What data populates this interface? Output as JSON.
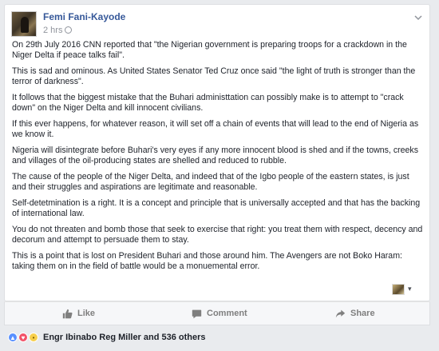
{
  "post": {
    "author": "Femi Fani-Kayode",
    "time": "2 hrs",
    "paragraphs": [
      "On 29th July 2016 CNN reported that \"the Nigerian government is preparing troops for a crackdown in the Niger Delta if peace talks fail\".",
      "This is sad and ominous. As United States Senator Ted Cruz once said \"the light of truth is stronger than the terror of darkness\".",
      "It follows that the biggest mistake that the Buhari administtation can possibly make is to attempt to \"crack down\" on the Niger Delta and kill innocent civilians.",
      "If this ever happens, for whatever reason, it will set off a chain of events that will lead to the end of Nigeria as we know it.",
      "Nigeria will disintegrate before Buhari's very eyes if any more innocent blood is shed and if the towns, creeks and villages of the oil-producing states are shelled and reduced to rubble.",
      "The cause of the people of the Niger Delta, and indeed that of the Igbo people of the eastern states, is just and their struggles and aspirations are legitimate and reasonable.",
      "Self-detetmination is a right. It is a concept and principle that is universally accepted and that has the backing of international law.",
      "You do not threaten and bomb those that seek to exercise that right: you treat them with respect, decency and decorum and attempt to persuade them to stay.",
      "This is a point that is lost on President Buhari and those around him. The Avengers are not Boko Haram: taking them on in the field of battle would be a monuemental error."
    ]
  },
  "actions": {
    "like": "Like",
    "comment": "Comment",
    "share": "Share"
  },
  "reactions": {
    "icons": [
      "like-reaction-icon",
      "love-reaction-icon",
      "sad-reaction-icon"
    ],
    "summary": "Engr Ibinabo Reg Miller and 536 others"
  },
  "colors": {
    "link": "#365899",
    "meta": "#90949c",
    "like": "#5890ff",
    "love": "#f25268",
    "sad": "#f7cf4d"
  }
}
